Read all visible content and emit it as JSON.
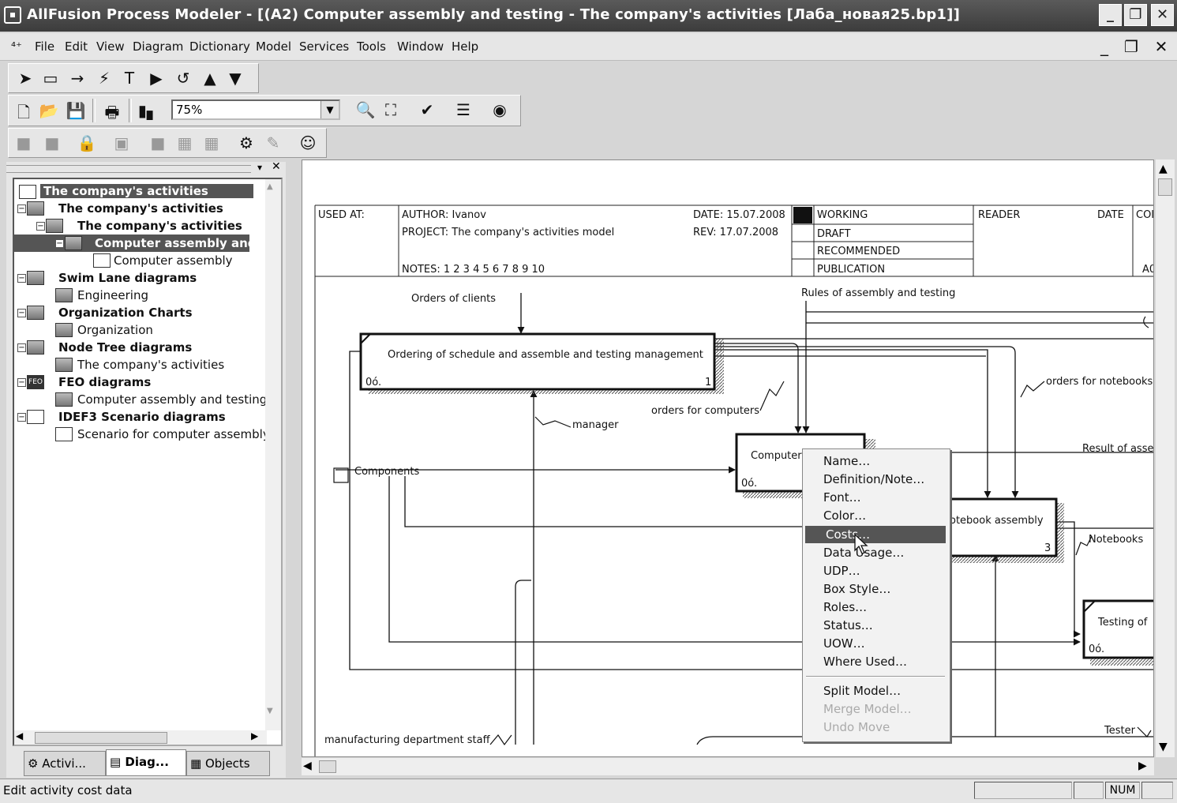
{
  "window": {
    "title": "AllFusion Process Modeler - [(A2) Computer assembly and testing - The company's activities  [Лаба_новая25.bp1]]"
  },
  "menu": [
    "File",
    "Edit",
    "View",
    "Diagram",
    "Dictionary",
    "Model",
    "Services",
    "Tools",
    "Window",
    "Help"
  ],
  "toolbar": {
    "zoom_value": "75%"
  },
  "tree": [
    {
      "label": "The company's activities",
      "bold": true,
      "selected": true
    },
    {
      "label": "The company's activities",
      "bold": true
    },
    {
      "label": "The company's activities",
      "bold": true
    },
    {
      "label": "Computer assembly and",
      "bold": true,
      "selected": true
    },
    {
      "label": "Computer assembly",
      "bold": false
    },
    {
      "label": "Swim Lane diagrams",
      "bold": true
    },
    {
      "label": "Engineering",
      "bold": false
    },
    {
      "label": "Organization Charts",
      "bold": true
    },
    {
      "label": "Organization",
      "bold": false
    },
    {
      "label": "Node Tree diagrams",
      "bold": true
    },
    {
      "label": "The company's activities",
      "bold": false
    },
    {
      "label": "FEO diagrams",
      "bold": true
    },
    {
      "label": "Computer assembly and testing",
      "bold": false
    },
    {
      "label": "IDEF3 Scenario diagrams",
      "bold": true
    },
    {
      "label": "Scenario for computer assembly",
      "bold": false
    }
  ],
  "tabs": {
    "activities": "Activi...",
    "diagrams": "Diag...",
    "objects": "Objects"
  },
  "frame": {
    "used_at": "USED AT:",
    "author": "AUTHOR:  Ivanov",
    "project": "PROJECT:  The company's activities model",
    "notes": "NOTES:  1  2  3  4  5  6  7  8  9  10",
    "date": "DATE: 15.07.2008",
    "rev": "REV:   17.07.2008",
    "working": "WORKING",
    "draft": "DRAFT",
    "recommended": "RECOMMENDED",
    "publication": "PUBLICATION",
    "reader": "READER",
    "date2": "DATE",
    "context": "COI",
    "node": "A0"
  },
  "diagram": {
    "box1_title": "Ordering of schedule and assemble and testing management",
    "box1_code": "0ó.",
    "box1_num": "1",
    "box2_title": "Computer",
    "box2_code": "0ó.",
    "box3_title": "otebook assembly",
    "box3_num": "3",
    "box4_title": "Testing of",
    "box4_code": "0ó.",
    "labels": {
      "orders_clients": "Orders of clients",
      "rules": "Rules of assembly and testing",
      "orders_notebooks": "orders for notebooks",
      "orders_computers": "orders for computers",
      "manager": "manager",
      "components": "Components",
      "result": "Result of asse",
      "notebooks": "Notebooks",
      "staff": "manufacturing department staff",
      "tester": "Tester"
    }
  },
  "context_menu": [
    {
      "label": "Name…",
      "state": "normal"
    },
    {
      "label": "Definition/Note…",
      "state": "normal"
    },
    {
      "label": "Font…",
      "state": "normal"
    },
    {
      "label": "Color…",
      "state": "normal"
    },
    {
      "label": "Costs…",
      "state": "selected"
    },
    {
      "label": "Data Usage…",
      "state": "normal"
    },
    {
      "label": "UDP…",
      "state": "normal"
    },
    {
      "label": "Box Style…",
      "state": "normal"
    },
    {
      "label": "Roles…",
      "state": "normal"
    },
    {
      "label": "Status…",
      "state": "normal"
    },
    {
      "label": "UOW…",
      "state": "normal"
    },
    {
      "label": "Where Used…",
      "state": "normal"
    },
    {
      "label": "Split Model…",
      "state": "normal"
    },
    {
      "label": "Merge Model…",
      "state": "disabled"
    },
    {
      "label": "Undo Move",
      "state": "disabled"
    }
  ],
  "status": {
    "message": "Edit activity cost data",
    "num": "NUM"
  }
}
